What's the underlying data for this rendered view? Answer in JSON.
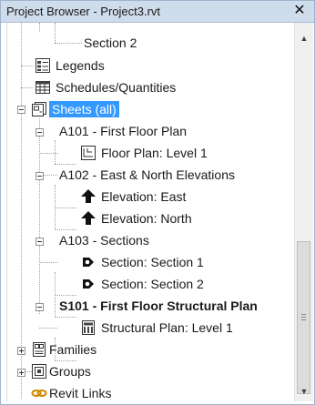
{
  "window": {
    "title": "Project Browser - Project3.rvt",
    "close_glyph": "✕"
  },
  "tree": {
    "items": [
      {
        "label": "Section 2",
        "icon": "none",
        "level": 3,
        "expander": "none"
      },
      {
        "label": "Legends",
        "icon": "legend-icon",
        "level": 1,
        "expander": "none"
      },
      {
        "label": "Schedules/Quantities",
        "icon": "schedule-icon",
        "level": 1,
        "expander": "none"
      },
      {
        "label": "Sheets (all)",
        "icon": "sheets-icon",
        "level": 1,
        "expander": "minus",
        "selected": true
      },
      {
        "label": "A101 - First Floor Plan",
        "icon": "none",
        "level": 2,
        "expander": "minus"
      },
      {
        "label": "Floor Plan: Level 1",
        "icon": "floor-plan-icon",
        "level": 3,
        "expander": "none"
      },
      {
        "label": "A102 - East & North Elevations",
        "icon": "none",
        "level": 2,
        "expander": "minus"
      },
      {
        "label": "Elevation: East",
        "icon": "elevation-icon",
        "level": 3,
        "expander": "none"
      },
      {
        "label": "Elevation: North",
        "icon": "elevation-icon",
        "level": 3,
        "expander": "none"
      },
      {
        "label": "A103 - Sections",
        "icon": "none",
        "level": 2,
        "expander": "minus"
      },
      {
        "label": "Section: Section 1",
        "icon": "section-icon",
        "level": 3,
        "expander": "none"
      },
      {
        "label": "Section: Section 2",
        "icon": "section-icon",
        "level": 3,
        "expander": "none"
      },
      {
        "label": "S101 - First Floor Structural Plan",
        "icon": "none",
        "level": 2,
        "expander": "minus",
        "bold": true
      },
      {
        "label": "Structural Plan: Level 1",
        "icon": "structural-plan-icon",
        "level": 3,
        "expander": "none"
      },
      {
        "label": "Families",
        "icon": "families-icon",
        "level": 1,
        "expander": "plus"
      },
      {
        "label": "Groups",
        "icon": "groups-icon",
        "level": 1,
        "expander": "plus"
      },
      {
        "label": "Revit Links",
        "icon": "revit-links-icon",
        "level": 1,
        "expander": "none"
      }
    ]
  },
  "scrollbar": {
    "up_glyph": "▲",
    "down_glyph": "▼"
  },
  "colors": {
    "selection": "#3399ff",
    "titlebar": "#cfdcec"
  }
}
